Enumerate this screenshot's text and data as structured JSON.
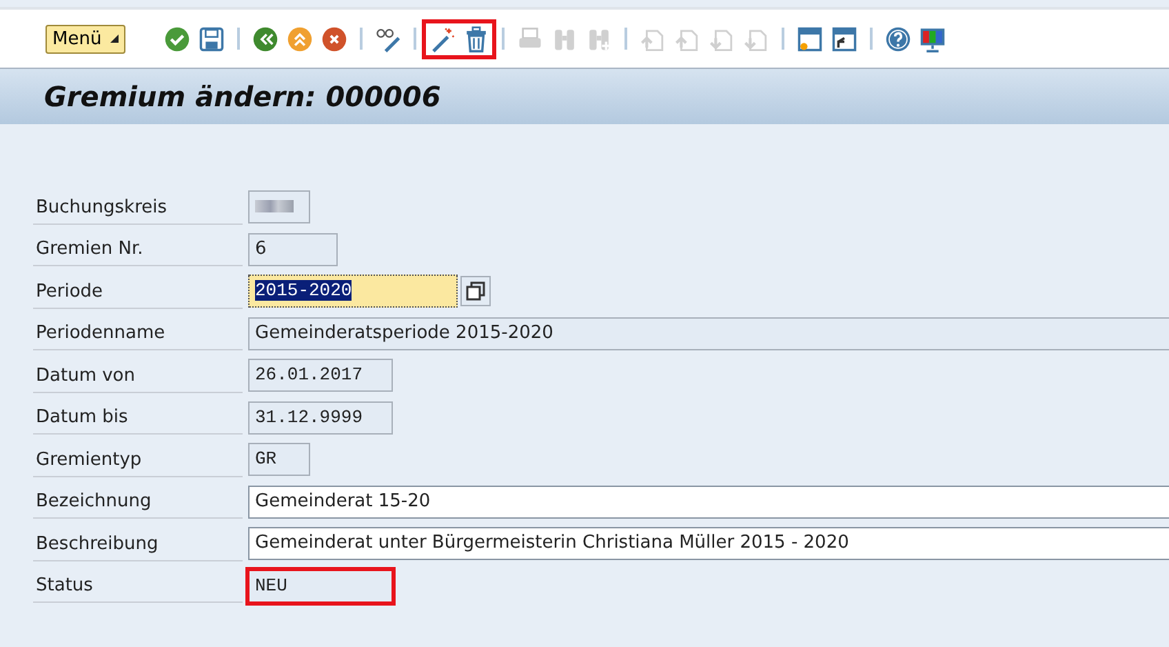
{
  "toolbar": {
    "menu_label": "Menü",
    "groups": [
      {
        "highlighted": false,
        "icons": [
          {
            "kind": "check",
            "disabled": false
          },
          {
            "kind": "save",
            "disabled": false
          }
        ]
      },
      {
        "highlighted": false,
        "icons": [
          {
            "kind": "back",
            "disabled": false
          },
          {
            "kind": "up",
            "disabled": false
          },
          {
            "kind": "cancel",
            "disabled": false
          }
        ]
      },
      {
        "highlighted": false,
        "icons": [
          {
            "kind": "display",
            "disabled": false
          }
        ]
      },
      {
        "highlighted": true,
        "icons": [
          {
            "kind": "wand",
            "disabled": false
          },
          {
            "kind": "trash",
            "disabled": false
          }
        ]
      },
      {
        "highlighted": false,
        "icons": [
          {
            "kind": "print",
            "disabled": true
          },
          {
            "kind": "find",
            "disabled": true
          },
          {
            "kind": "findnext",
            "disabled": true
          }
        ]
      },
      {
        "highlighted": false,
        "icons": [
          {
            "kind": "first",
            "disabled": true
          },
          {
            "kind": "prev",
            "disabled": true
          },
          {
            "kind": "next",
            "disabled": true
          },
          {
            "kind": "last",
            "disabled": true
          }
        ]
      },
      {
        "highlighted": false,
        "icons": [
          {
            "kind": "newwin",
            "disabled": false
          },
          {
            "kind": "shortcut",
            "disabled": false
          }
        ]
      },
      {
        "highlighted": false,
        "icons": [
          {
            "kind": "help",
            "disabled": false
          },
          {
            "kind": "layout",
            "disabled": false
          }
        ]
      }
    ]
  },
  "title": "Gremium ändern: 000006",
  "fields": [
    {
      "label": "Buchungskreis",
      "kind": "blurred",
      "highlighted": false
    },
    {
      "label": "Gremien Nr.",
      "value": "6",
      "kind": "readonly",
      "mono": false,
      "highlighted": false
    },
    {
      "label": "Periode",
      "value": "2015-2020",
      "kind": "focused",
      "mono": true,
      "highlighted": false
    },
    {
      "label": "Periodenname",
      "value": "Gemeinderatsperiode 2015-2020",
      "kind": "readonly",
      "mono": false,
      "highlighted": false
    },
    {
      "label": "Datum von",
      "value": "26.01.2017",
      "kind": "readonly",
      "mono": true,
      "highlighted": false
    },
    {
      "label": "Datum bis",
      "value": "31.12.9999",
      "kind": "readonly",
      "mono": true,
      "highlighted": false
    },
    {
      "label": "Gremientyp",
      "value": "GR",
      "kind": "readonly",
      "mono": true,
      "highlighted": false
    },
    {
      "label": "Bezeichnung",
      "value": "Gemeinderat 15-20",
      "kind": "input",
      "mono": false,
      "highlighted": false
    },
    {
      "label": "Beschreibung",
      "value": "Gemeinderat unter Bürgermeisterin Christiana Müller 2015 - 2020",
      "kind": "input",
      "mono": false,
      "highlighted": false
    },
    {
      "label": "Status",
      "value": "NEU",
      "kind": "readonly",
      "mono": true,
      "highlighted": true
    }
  ]
}
